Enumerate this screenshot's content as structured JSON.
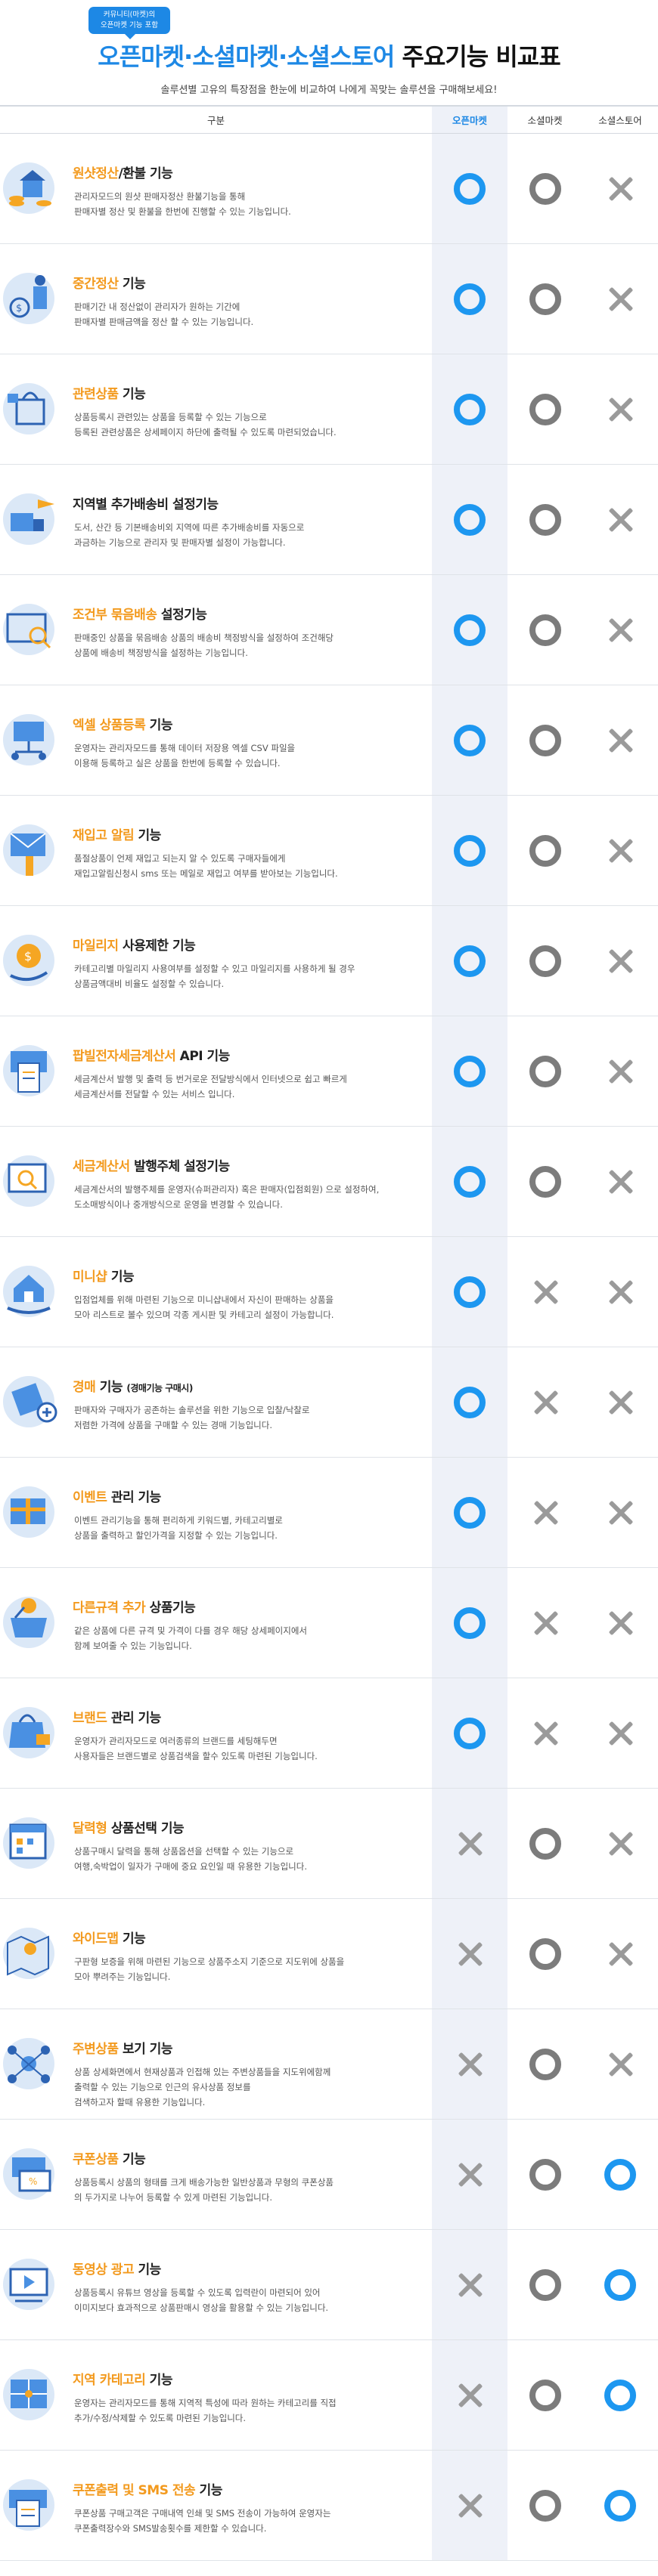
{
  "header": {
    "badge_line1": "커뮤니티(마켓)의",
    "badge_line2": "오픈마켓 기능 포함",
    "title_blue": "오픈마켓·소셜마켓·소셜스토어",
    "title_dark": " 주요기능 비교표",
    "subtitle": "솔루션별 고유의 특장점을 한눈에 비교하여 나에게 꼭맞는 솔루션을 구매해보세요!"
  },
  "columns": [
    "구분",
    "오픈마켓",
    "소셜마켓",
    "소셜스토어"
  ],
  "marks": {
    "o_blue": "O",
    "o_gray": "O",
    "x_gray": "X"
  },
  "colors": {
    "blue": "#1d97f0",
    "orange": "#f39a1e",
    "gray": "#7c7c7c",
    "open_market_bg": "#eef1f8"
  },
  "features": [
    {
      "icon": "coin-stack-icon",
      "hl": "원샷정산",
      "rest": "/환불 기능",
      "desc": [
        "관리자모드의 원샷 판매자정산 환불기능을 통해",
        "판매자별 정산 및 환불을 한번에 진행할 수 있는 기능입니다."
      ],
      "marks": [
        "o_blue",
        "o_gray",
        "x_gray"
      ]
    },
    {
      "icon": "coin-person-icon",
      "hl": "중간정산",
      "rest": " 기능",
      "desc": [
        "판매기간 내 정산없이 관리자가 원하는 기간에",
        "판매자별 판매금액을 정산 할 수 있는 기능입니다."
      ],
      "marks": [
        "o_blue",
        "o_gray",
        "x_gray"
      ]
    },
    {
      "icon": "shopping-bag-icon",
      "hl": "관련상품",
      "rest": " 기능",
      "desc": [
        "상품등록시 관련있는 상품을 등록할 수 있는 기능으로",
        "등록된 관련상품은 상세페이지 하단에 출력될 수 있도록 마련되었습니다."
      ],
      "marks": [
        "o_blue",
        "o_gray",
        "x_gray"
      ]
    },
    {
      "icon": "delivery-plane-icon",
      "hl": "",
      "rest": "지역별 추가배송비 설정기능",
      "desc": [
        "도서, 산간 등 기본배송비외 지역에 따른 추가배송비를 자동으로",
        "과금하는 기능으로 관리자 및 판매자별 설정이 가능합니다."
      ],
      "marks": [
        "o_blue",
        "o_gray",
        "x_gray"
      ]
    },
    {
      "icon": "box-search-icon",
      "hl": "조건부 묶음배송",
      "rest": " 설정기능",
      "desc": [
        "판매중인 상품을 묶음배송 상품의 배송비 책정방식을 설정하여 조건해당",
        "상품에 배송비 책정방식을 설정하는 기능입니다."
      ],
      "marks": [
        "o_blue",
        "o_gray",
        "x_gray"
      ]
    },
    {
      "icon": "folder-network-icon",
      "hl": "엑셀 상품등록",
      "rest": " 기능",
      "desc": [
        "운영자는 관리자모드를 통해 데이터 저장용 엑셀 CSV 파일을",
        "이용해 등록하고 실은 상품을 한번에 등록할 수 있습니다."
      ],
      "marks": [
        "o_blue",
        "o_gray",
        "x_gray"
      ]
    },
    {
      "icon": "mail-hand-icon",
      "hl": "재입고 알림",
      "rest": " 기능",
      "desc": [
        "품절상품이 언제 재입고 되는지 알 수 있도록 구매자들에게",
        "재입고알림신청시 sms 또는 메일로 재입고 여부를 받아보는 기능입니다."
      ],
      "marks": [
        "o_blue",
        "o_gray",
        "x_gray"
      ]
    },
    {
      "icon": "coin-hand-icon",
      "hl": "마일리지",
      "rest": " 사용제한 기능",
      "desc": [
        "카테고리별 마일리지 사용여부를 설정할 수 있고 마일리지를 사용하게 될 경우",
        "상품금액대비 비율도 설정할 수 있습니다."
      ],
      "marks": [
        "o_blue",
        "o_gray",
        "x_gray"
      ]
    },
    {
      "icon": "receipt-printer-icon",
      "hl": "팝빌전자세금계산서",
      "rest": " API 기능",
      "desc": [
        "세금계산서 발행 및 출력 등 번거로운 전달방식에서 인터넷으로 쉽고 빠르게",
        "세금계산서를 전달할 수 있는 서비스 입니다."
      ],
      "marks": [
        "o_blue",
        "o_gray",
        "x_gray"
      ]
    },
    {
      "icon": "invoice-search-icon",
      "hl": "세금계산서",
      "rest": " 발행주체 설정기능",
      "desc": [
        "세금계산서의 발행주체를 운영자(슈퍼관리자) 혹은 판매자(입점회원) 으로 설정하여,",
        "도소매방식이나 중개방식으로 운영을 변경할 수 있습니다."
      ],
      "marks": [
        "o_blue",
        "o_gray",
        "x_gray"
      ]
    },
    {
      "icon": "house-hand-icon",
      "hl": "미니샵",
      "rest": " 기능",
      "desc": [
        "입점업체를 위해 마련된 기능으로 미니샵내에서 자신이 판매하는 상품을",
        "모아 리스트로 볼수 있으며 각종 게시판 및 카테고리 설정이 가능합니다."
      ],
      "marks": [
        "o_blue",
        "x_gray",
        "x_gray"
      ]
    },
    {
      "icon": "auction-hammer-icon",
      "hl": "경매",
      "rest": " 기능",
      "small": "(경매기능 구매시)",
      "desc": [
        "판매자와 구매자가 공존하는 솔루션을 위한 기능으로 입찰/낙찰로",
        "저렴한 가격에 상품을 구매할 수 있는 경매 기능입니다."
      ],
      "marks": [
        "o_blue",
        "x_gray",
        "x_gray"
      ]
    },
    {
      "icon": "gift-calendar-icon",
      "hl": "이벤트",
      "rest": " 관리 기능",
      "desc": [
        "이벤트 관리기능을 통해 편리하게 키워드별, 카테고리별로",
        "상품을 출력하고 할인가격을 지정할 수 있는 기능입니다."
      ],
      "marks": [
        "o_blue",
        "x_gray",
        "x_gray"
      ]
    },
    {
      "icon": "basket-add-icon",
      "hl": "다른규격 추가",
      "rest": " 상품기능",
      "desc": [
        "같은 상품에 다른 규격 및 가격이 다를 경우 해당 상세페이지에서",
        "함께 보여줄 수 있는 기능입니다."
      ],
      "marks": [
        "o_blue",
        "x_gray",
        "x_gray"
      ]
    },
    {
      "icon": "brand-bag-icon",
      "hl": "브랜드",
      "rest": " 관리 기능",
      "desc": [
        "운영자가 관리자모드로 여러종류의 브랜드를 세팅해두면",
        "사용자들은 브랜드별로 상품검색을 할수 있도록 마련된 기능입니다."
      ],
      "marks": [
        "o_blue",
        "x_gray",
        "x_gray"
      ]
    },
    {
      "icon": "calendar-grid-icon",
      "hl": "달력형",
      "rest": " 상품선택 기능",
      "desc": [
        "상품구매시 달력을 통해 상품옵션을 선택할 수 있는 기능으로",
        "여행,숙박업이 일자가 구매에 중요 요인일 때 유용한 기능입니다."
      ],
      "marks": [
        "x_gray",
        "o_gray",
        "x_gray"
      ]
    },
    {
      "icon": "map-pin-icon",
      "hl": "와이드맵",
      "rest": " 기능",
      "desc": [
        "구판형 보증을 위해 마련된 기능으로 상품주소지 기준으로 지도위에 상품을",
        "모아 뿌려주는 기능입니다."
      ],
      "marks": [
        "x_gray",
        "o_gray",
        "x_gray"
      ]
    },
    {
      "icon": "network-nodes-icon",
      "hl": "주변상품",
      "rest": " 보기 기능",
      "desc": [
        "상품 상세화면에서 현재상품과 인접해 있는 주변상품들을 지도위에함께",
        "출력할 수 있는 기능으로 인근의 유사상품 정보를",
        "검색하고자 할때 유용한 기능입니다."
      ],
      "marks": [
        "x_gray",
        "o_gray",
        "x_gray"
      ]
    },
    {
      "icon": "coupon-ticket-icon",
      "hl": "쿠폰상품",
      "rest": " 기능",
      "desc": [
        "상품등록시 상품의 형태를 크게 배송가능한 일반상품과 무형의 쿠폰상품",
        "의 두가지로 나누어 등록할 수 있게 마련된 기능입니다."
      ],
      "marks": [
        "x_gray",
        "o_gray",
        "o_blue"
      ]
    },
    {
      "icon": "video-play-icon",
      "hl": "동영상 광고",
      "rest": " 기능",
      "desc": [
        "상품등록시 유튜브 영상을 등록할 수 있도록 입력란이 마련되어 있어",
        "이미지보다 효과적으로 상품판매시 영상을 활용할 수 있는 기능입니다."
      ],
      "marks": [
        "x_gray",
        "o_gray",
        "o_blue"
      ]
    },
    {
      "icon": "map-grid-icon",
      "hl": "지역 카테고리",
      "rest": " 기능",
      "desc": [
        "운영자는 관리자모드를 통해 지역적 특성에 따라 원하는 카테고리를 직접",
        "추가/수정/삭제할 수 있도록 마련된 기능입니다."
      ],
      "marks": [
        "x_gray",
        "o_gray",
        "o_blue"
      ]
    },
    {
      "icon": "coupon-printer-icon",
      "hl": "쿠폰출력 및 SMS 전송",
      "rest": " 기능",
      "desc": [
        "쿠폰상품 구매고객은 구매내역 인쇄 및 SMS 전송이 가능하여 운영자는",
        "쿠폰출력장수와 SMS발송횟수를 제한할 수 있습니다."
      ],
      "marks": [
        "x_gray",
        "o_gray",
        "o_blue"
      ]
    }
  ]
}
